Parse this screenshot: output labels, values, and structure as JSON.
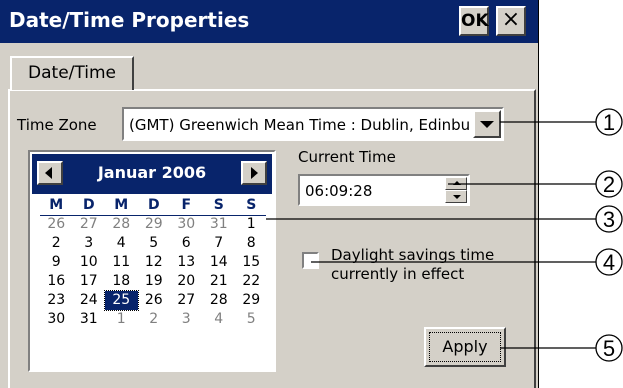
{
  "window": {
    "title": "Date/Time Properties",
    "ok_label": "OK",
    "close_label": "×"
  },
  "tabs": [
    {
      "label": "Date/Time"
    }
  ],
  "timezone": {
    "label": "Time Zone",
    "value": "(GMT) Greenwich Mean Time : Dublin, Edinbu"
  },
  "calendar": {
    "month_label": "Januar 2006",
    "weekdays": [
      "M",
      "D",
      "M",
      "D",
      "F",
      "S",
      "S"
    ],
    "weeks": [
      [
        {
          "d": "26",
          "o": true
        },
        {
          "d": "27",
          "o": true
        },
        {
          "d": "28",
          "o": true
        },
        {
          "d": "29",
          "o": true
        },
        {
          "d": "30",
          "o": true
        },
        {
          "d": "31",
          "o": true
        },
        {
          "d": "1",
          "o": false
        }
      ],
      [
        {
          "d": "2",
          "o": false
        },
        {
          "d": "3",
          "o": false
        },
        {
          "d": "4",
          "o": false
        },
        {
          "d": "5",
          "o": false
        },
        {
          "d": "6",
          "o": false
        },
        {
          "d": "7",
          "o": false
        },
        {
          "d": "8",
          "o": false
        }
      ],
      [
        {
          "d": "9",
          "o": false
        },
        {
          "d": "10",
          "o": false
        },
        {
          "d": "11",
          "o": false
        },
        {
          "d": "12",
          "o": false
        },
        {
          "d": "13",
          "o": false
        },
        {
          "d": "14",
          "o": false
        },
        {
          "d": "15",
          "o": false
        }
      ],
      [
        {
          "d": "16",
          "o": false
        },
        {
          "d": "17",
          "o": false
        },
        {
          "d": "18",
          "o": false
        },
        {
          "d": "19",
          "o": false
        },
        {
          "d": "20",
          "o": false
        },
        {
          "d": "21",
          "o": false
        },
        {
          "d": "22",
          "o": false
        }
      ],
      [
        {
          "d": "23",
          "o": false
        },
        {
          "d": "24",
          "o": false
        },
        {
          "d": "25",
          "o": false,
          "sel": true
        },
        {
          "d": "26",
          "o": false
        },
        {
          "d": "27",
          "o": false
        },
        {
          "d": "28",
          "o": false
        },
        {
          "d": "29",
          "o": false
        }
      ],
      [
        {
          "d": "30",
          "o": false
        },
        {
          "d": "31",
          "o": false
        },
        {
          "d": "1",
          "o": true
        },
        {
          "d": "2",
          "o": true
        },
        {
          "d": "3",
          "o": true
        },
        {
          "d": "4",
          "o": true
        },
        {
          "d": "5",
          "o": true
        }
      ]
    ]
  },
  "current_time": {
    "label": "Current Time",
    "value": "06:09:28"
  },
  "daylight": {
    "label": "Daylight savings time currently in effect",
    "checked": false
  },
  "apply_label": "Apply",
  "callouts": [
    "1",
    "2",
    "3",
    "4",
    "5"
  ],
  "colors": {
    "titlebar": "#08246b",
    "face": "#d4d0c8"
  }
}
